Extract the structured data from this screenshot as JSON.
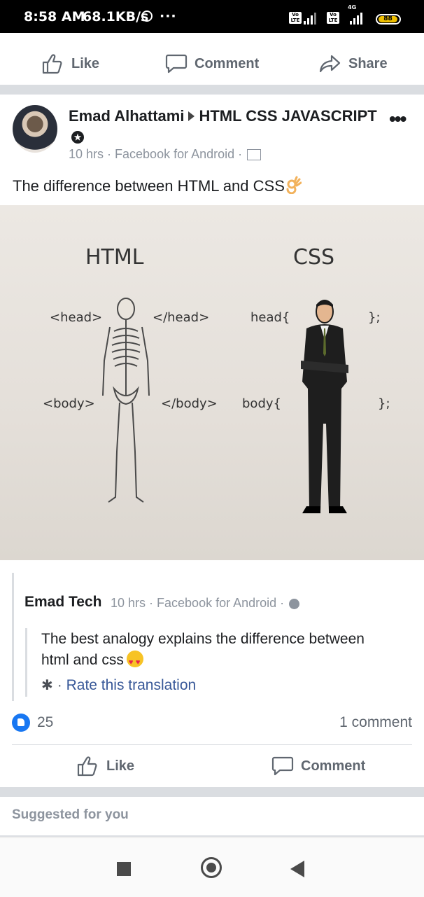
{
  "status_bar": {
    "time": "8:58 AM",
    "network_speed": "68.1KB/s",
    "overflow": "···",
    "lte_1": "Vo LTE",
    "lte_2": "Vo LTE",
    "network_type": "4G",
    "battery": "88"
  },
  "top_actions": {
    "like": "Like",
    "comment": "Comment",
    "share": "Share"
  },
  "post": {
    "author": "Emad Alhattami",
    "group": "HTML CSS JAVASCRIPT",
    "time": "10 hrs",
    "source": "Facebook for Android",
    "text": "The difference between HTML and CSS",
    "image": {
      "left_heading": "HTML",
      "right_heading": "CSS",
      "html_head_open": "<head>",
      "html_head_close": "</head>",
      "html_body_open": "<body>",
      "html_body_close": "</body>",
      "css_head_open": "head{",
      "css_head_close": "};",
      "css_body_open": "body{",
      "css_body_close": "};"
    }
  },
  "shared_post": {
    "author": "Emad Tech",
    "time": "10 hrs",
    "source": "Facebook for Android",
    "text": "The best analogy explains the difference between html and css",
    "translation_link": "Rate this translation"
  },
  "stats": {
    "reactions_count": "25",
    "comments_count": "1 comment"
  },
  "bottom_actions": {
    "like": "Like",
    "comment": "Comment"
  },
  "suggested": {
    "label": "Suggested for you"
  },
  "colors": {
    "link": "#385898",
    "like_blue": "#1877f2",
    "muted": "#8d949e"
  }
}
